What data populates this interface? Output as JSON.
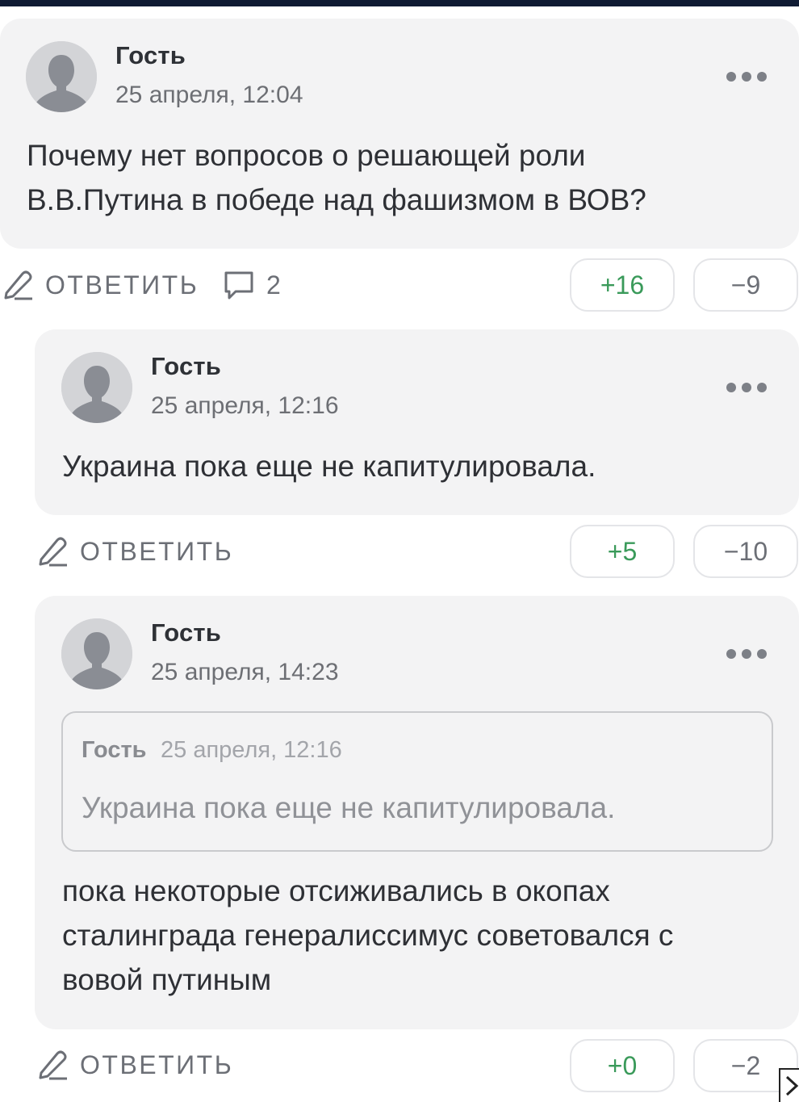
{
  "comments": [
    {
      "author": "Гость",
      "date": "25 апреля, 12:04",
      "text_lines": [
        "Почему нет вопросов о решающей роли",
        "В.В.Путина в победе над фашизмом в ВОВ?"
      ],
      "reply_label": "ОТВЕТИТЬ",
      "replies_count": "2",
      "upvotes": "+16",
      "downvotes": "−9"
    },
    {
      "author": "Гость",
      "date": "25 апреля, 12:16",
      "text_lines": [
        "Украина пока еще не капитулировала."
      ],
      "reply_label": "ОТВЕТИТЬ",
      "upvotes": "+5",
      "downvotes": "−10"
    },
    {
      "author": "Гость",
      "date": "25 апреля, 14:23",
      "quote": {
        "author": "Гость",
        "date": "25 апреля, 12:16",
        "text": "Украина пока еще не капитулировала."
      },
      "text_lines": [
        "пока некоторые отсиживались в окопах",
        "сталинграда генералиссимус советовался с",
        "вовой путиным"
      ],
      "reply_label": "ОТВЕТИТЬ",
      "upvotes": "+0",
      "downvotes": "−2"
    }
  ],
  "icons": {
    "avatar": "user-silhouette-icon",
    "more": "more-dots-icon",
    "reply": "pencil-icon",
    "replies": "comment-bubble-icon"
  },
  "colors": {
    "card_bg": "#f3f3f4",
    "upvote": "#3a9a5a",
    "muted": "#6c6f76",
    "topbar": "#0f1b33"
  }
}
